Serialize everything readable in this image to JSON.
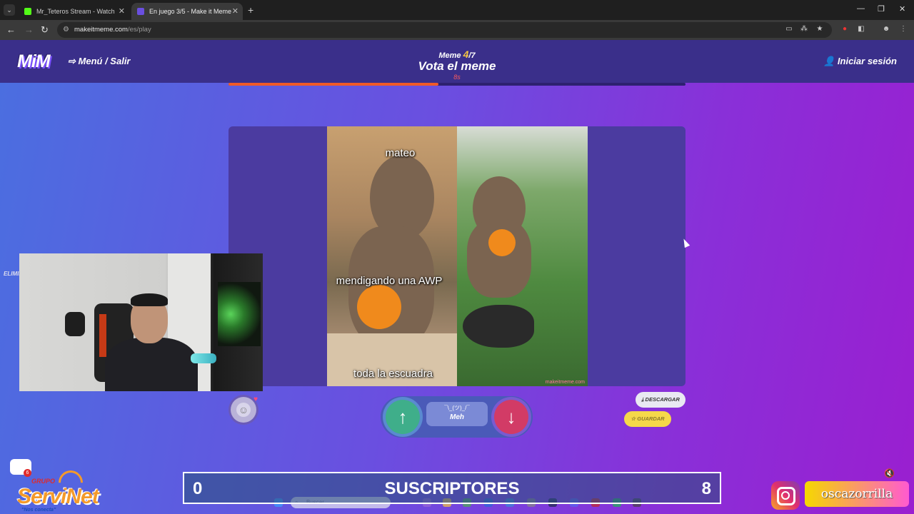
{
  "browser": {
    "tabs": [
      {
        "title": "Mr_Teteros Stream - Watch Live",
        "active": false
      },
      {
        "title": "En juego 3/5 - Make it Meme",
        "active": true
      }
    ],
    "url_host": "makeitmeme.com",
    "url_path": "/es/play",
    "icons": [
      "back-icon",
      "forward-icon",
      "reload-icon",
      "site-info-icon",
      "cast-icon",
      "translate-icon",
      "star-icon",
      "extension-icon",
      "extensions-icon",
      "profile-icon",
      "more-icon"
    ]
  },
  "game": {
    "logo": "MiM",
    "menu_label": "Menú / Salir",
    "login_label": "Iniciar sesión",
    "meme_counter_prefix": "Meme",
    "meme_counter_current": "4",
    "meme_counter_total": "/7",
    "phase_title": "Vota el meme",
    "timer": "8s",
    "progress_fraction": 0.46,
    "accent_color": "#f05a28"
  },
  "meme": {
    "captions": {
      "top": "mateo",
      "middle": "mendigando una AWP",
      "bottom": "toda la escuadra"
    },
    "watermark": "makeitmeme.com"
  },
  "voting": {
    "shrug": "¯\\_(ツ)_/¯",
    "meh_label": "Meh",
    "download_label": "DESCARGAR",
    "save_label": "GUARDAR"
  },
  "overlay": {
    "side_label": "ELIMIN",
    "subs_left": "0",
    "subs_title": "SUSCRIPTORES",
    "subs_right": "8",
    "sponsor_grupo": "GRUPO",
    "sponsor_name": "ServiNet",
    "sponsor_slogan": "\"Nos conecta\"",
    "notif_count": "6",
    "instagram_handle": "oscazorrilla",
    "taskbar_search": "Buscar"
  }
}
